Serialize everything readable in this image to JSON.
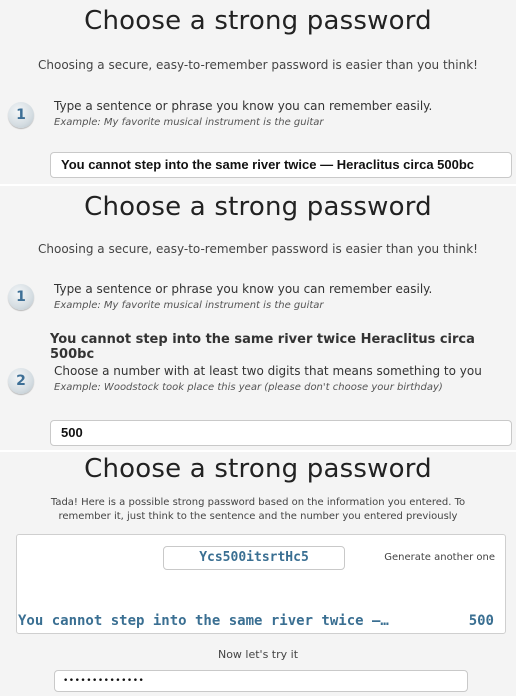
{
  "panel1": {
    "title": "Choose a strong password",
    "subtitle": "Choosing a secure, easy-to-remember password is easier than you think!",
    "step1": {
      "number": "1",
      "text": "Type a sentence or phrase you know you can remember easily.",
      "example": "Example: My favorite musical instrument is the guitar"
    },
    "sentence_value": "You cannot step into the same river twice — Heraclitus circa 500bc"
  },
  "panel2": {
    "title": "Choose a strong password",
    "subtitle": "Choosing a secure, easy-to-remember password is easier than you think!",
    "step1": {
      "number": "1",
      "text": "Type a sentence or phrase you know you can remember easily.",
      "example": "Example: My favorite musical instrument is the guitar"
    },
    "sentence_display": "You cannot step into the same river twice Heraclitus circa 500bc",
    "step2": {
      "number": "2",
      "text": "Choose a number with at least two digits that means something to you",
      "example": "Example: Woodstock took place this year (please don't choose your birthday)"
    },
    "number_value": "500"
  },
  "panel3": {
    "title": "Choose a strong password",
    "intro_line1": "Tada! Here is a possible strong password based on the information you entered. To",
    "intro_line2": "remember it, just think to the sentence and the number you entered previously",
    "generated_password": "Ycs500itsrtHc5",
    "generate_another": "Generate another one",
    "sentence_mono": "You cannot step into the same river twice —…",
    "number_mono": "500",
    "try_label": "Now let's try it",
    "try_value": "••••••••••••••"
  },
  "colors": {
    "panel_bg": "#f4f4f4",
    "accent_blue": "#3a6f92",
    "step_badge_text": "#3d6f96"
  }
}
